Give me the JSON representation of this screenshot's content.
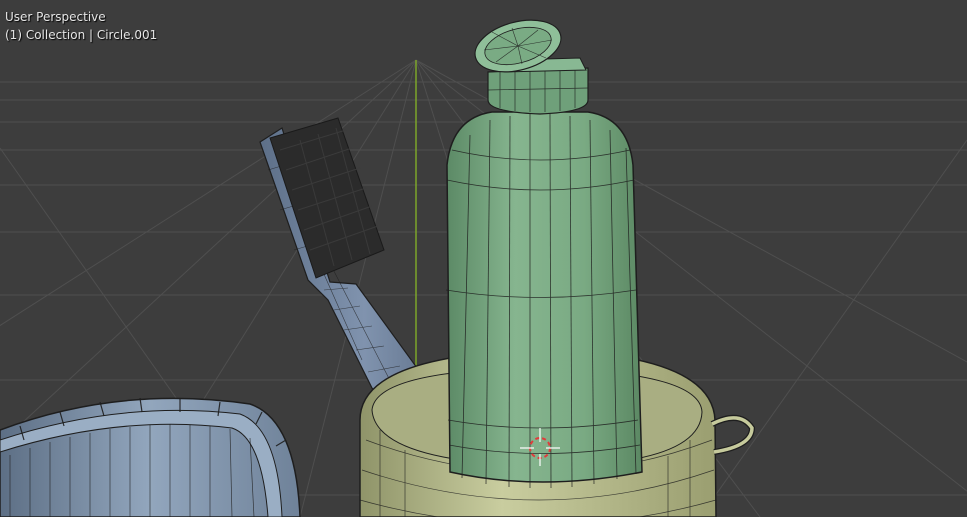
{
  "viewport": {
    "view_name": "User Perspective",
    "collection_info": "(1) Collection | Circle.001"
  },
  "objects": [
    {
      "name": "bottle",
      "color": "#76a57e"
    },
    {
      "name": "toothbrush",
      "color": "#6a7c95"
    },
    {
      "name": "cup",
      "color": "#c6ca9c"
    },
    {
      "name": "bowl",
      "color": "#8397ad"
    }
  ],
  "colors": {
    "background": "#3d3d3d",
    "grid_line": "#4f4f4f",
    "y_axis": "#7da52a",
    "wireframe": "#1e1e1e",
    "bristles": "#2b2b2b",
    "cursor_red": "#e03c3c"
  },
  "icons": [
    "3d-cursor-icon"
  ]
}
